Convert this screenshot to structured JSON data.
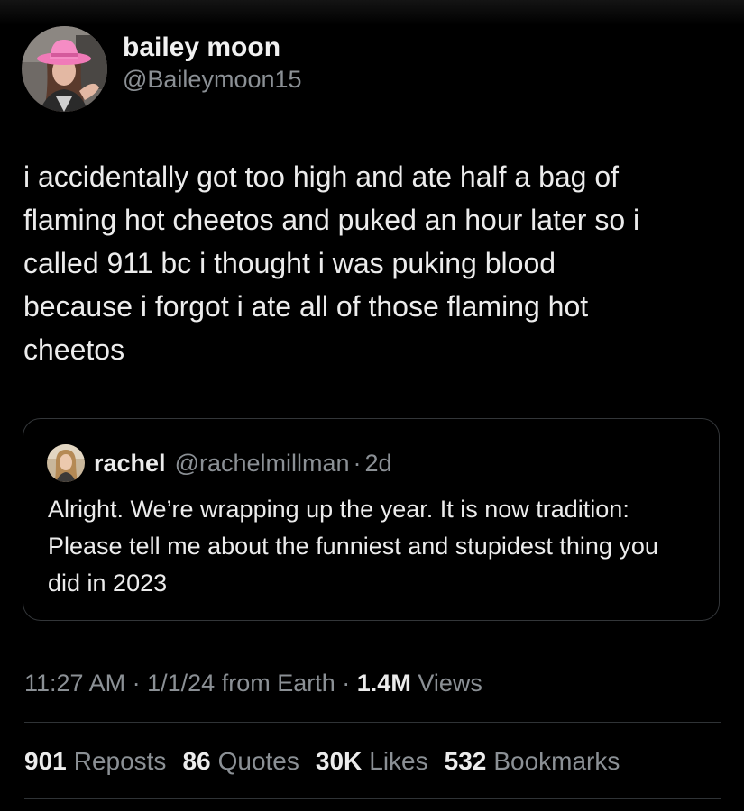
{
  "author": {
    "display_name": "bailey moon",
    "handle": "@Baileymoon15"
  },
  "tweet": {
    "text": "i accidentally got too high and ate half a bag of\nflaming hot cheetos and puked an hour later so i\ncalled 911 bc i thought i was puking blood\nbecause i forgot i ate all of those flaming hot\ncheetos"
  },
  "quote": {
    "name": "rachel",
    "handle": "@rachelmillman",
    "separator": "·",
    "time": "2d",
    "text": "Alright. We’re wrapping up the year. It is now tradition: Please tell me about the funniest and stupidest thing you did in 2023"
  },
  "meta": {
    "time": "11:27 AM",
    "sep1": "·",
    "date": "1/1/24",
    "source": "from Earth",
    "sep2": "·",
    "views_count": "1.4M",
    "views_label": "Views"
  },
  "stats": [
    {
      "count": "901",
      "label": "Reposts"
    },
    {
      "count": "86",
      "label": "Quotes"
    },
    {
      "count": "30K",
      "label": "Likes"
    },
    {
      "count": "532",
      "label": "Bookmarks"
    }
  ],
  "colors": {
    "background": "#000000",
    "text_primary": "#e7e9ea",
    "text_secondary": "#8b9095",
    "border": "#333639",
    "hat_pink": "#f07ab8"
  }
}
